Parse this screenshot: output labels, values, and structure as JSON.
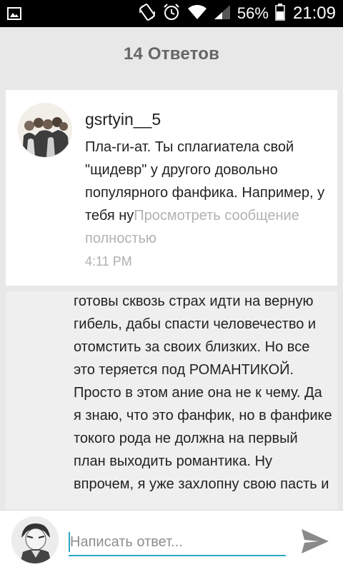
{
  "status_bar": {
    "battery": "56%",
    "time": "21:09",
    "icons": [
      "image-icon",
      "rotate-icon",
      "alarm-icon",
      "wifi-icon",
      "signal-icon",
      "battery-icon"
    ]
  },
  "header": {
    "title": "14 Ответов"
  },
  "reply": {
    "username": "gsrtyin__5",
    "text": "Пла-ги-ат.  Ты сплагиатела свой \"щидевр\" у другого довольно популярного фанфика. Например, у тебя ну",
    "more_link": "Просмотреть сообщение полностью",
    "time": "4:11 PM"
  },
  "reply2": {
    "text": "готовы сквозь страх идти на верную гибель,  дабы спасти человечество и отомстить за своих близких. Но все это теряется под РОМАНТИКОЙ. Просто в этом ание она не к чему. Да я знаю,  что это фанфик,  но в фанфике токого рода не должна на первый план выходить романтика. Ну впрочем, я уже захлопну свою пасть и"
  },
  "composer": {
    "placeholder": "Написать ответ..."
  },
  "colors": {
    "accent": "#2aa9c4",
    "link_gray": "#b2b2b2"
  }
}
